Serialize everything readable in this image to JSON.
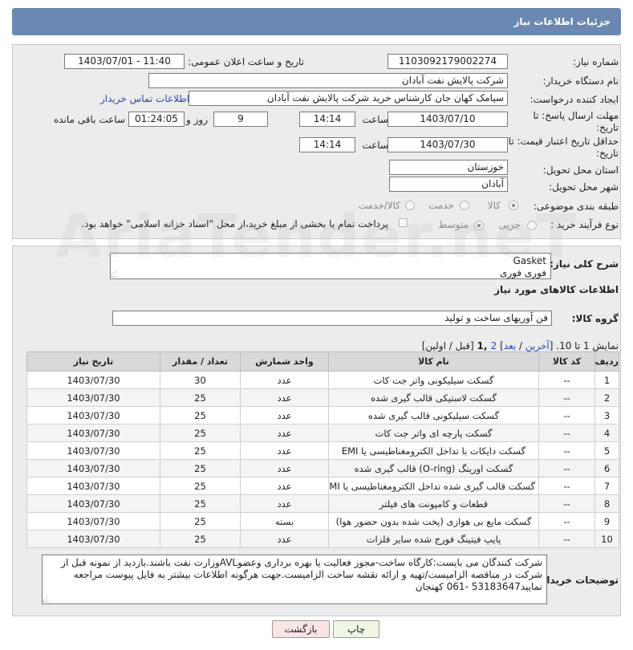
{
  "page": {
    "title": "جزئیات اطلاعات نیاز"
  },
  "form": {
    "need_number_label": "شماره نیاز:",
    "need_number": "1103092179002274",
    "announce_label": "تاریخ و ساعت اعلان عمومی:",
    "announce_value": "1403/07/01 - 11:40",
    "buyer_org_label": "نام دستگاه خریدار:",
    "buyer_org": "شرکت پالایش نفت آبادان",
    "creator_label": "ایجاد کننده درخواست:",
    "creator": "سیامک کهان جان کارشناس خرید شرکت پالایش نفت آبادان",
    "buyer_contact_link": "اطلاعات تماس خریدار",
    "reply_deadline_label": "مهلت ارسال پاسخ: تا تاریخ:",
    "reply_date": "1403/07/10",
    "time_label": "ساعت",
    "reply_time": "14:14",
    "days_value": "9",
    "days_label": "روز و",
    "remaining_time": "01:24:05",
    "remaining_label": "ساعت باقی مانده",
    "price_validity_label": "حداقل تاریخ اعتبار قیمت: تا تاریخ:",
    "price_date": "1403/07/30",
    "price_time": "14:14",
    "province_label": "استان محل تحویل:",
    "province": "خوزستان",
    "city_label": "شهر محل تحویل:",
    "city": "آبادان",
    "category_label": "طبقه بندی موضوعی:",
    "category_options": [
      "کالا",
      "خدمت",
      "کالا/خدمت"
    ],
    "process_label": "نوع فرآیند خرید :",
    "process_options": [
      "جزیی",
      "متوسط"
    ],
    "payment_note": "پرداخت تمام یا بخشی از مبلغ خرید،از محل \"اسناد خزانه اسلامی\" خواهد بود."
  },
  "watermark": "AriaTender.neT",
  "items_section": {
    "summary_label": "شرح کلی نیاز:",
    "summary_line1": "Gasket",
    "summary_line2": "فوری فوری",
    "goods_info_title": "اطلاعات کالاهای مورد نیاز",
    "goods_group_label": "گروه کالا:",
    "goods_group": "فن آوریهای ساخت و تولید",
    "pagination": {
      "prefix": "نمایش 1 تا 10. [",
      "last": "آخرین",
      "sep1": " / ",
      "next": "بعد",
      "sep2": "] ",
      "page2": "2",
      "page1": " ,1",
      "rest": " [قبل / اولین]"
    },
    "columns": [
      "ردیف",
      "کد کالا",
      "نام کالا",
      "واحد شمارش",
      "تعداد / مقدار",
      "تاریخ نیاز"
    ],
    "rows": [
      [
        "1",
        "--",
        "گسکت سیلیکونی واتر جت کات",
        "عدد",
        "30",
        "1403/07/30"
      ],
      [
        "2",
        "--",
        "گسکت لاستیکی قالب گیری شده",
        "عدد",
        "25",
        "1403/07/30"
      ],
      [
        "3",
        "--",
        "گسکت سیلیکونی قالب گیری شده",
        "عدد",
        "25",
        "1403/07/30"
      ],
      [
        "4",
        "--",
        "گسکت پارچه ای واتر جت کات",
        "عدد",
        "25",
        "1403/07/30"
      ],
      [
        "5",
        "--",
        "گسکت دایکات با تداخل الکترومغناطیسی یا EMI",
        "عدد",
        "25",
        "1403/07/30"
      ],
      [
        "6",
        "--",
        "گسکت اورینگ (O-ring) قالب گیری شده",
        "عدد",
        "25",
        "1403/07/30"
      ],
      [
        "7",
        "--",
        "گسکت قالب گیری شده تداخل الکترومغناطیسی یا EMI",
        "عدد",
        "25",
        "1403/07/30"
      ],
      [
        "8",
        "--",
        "قطعات و کامپونت های فیلتر",
        "عدد",
        "25",
        "1403/07/30"
      ],
      [
        "9",
        "--",
        "گسکت مایع بی هوازی (پخت شده بدون حضور هوا)",
        "بسته",
        "25",
        "1403/07/30"
      ],
      [
        "10",
        "--",
        "پایپ فیتینگ فورج شده سایر فلزات",
        "عدد",
        "25",
        "1403/07/30"
      ]
    ],
    "buyer_notes_label": "توضیحات خریدار:",
    "buyer_notes": "شرکت کنندگان می بایست:کارگاه ساخت-مجوز فعالیت یا بهره برداری وعضوAVLوزارت نفت باشند.بازدید از نمونه قبل از شرکت در مناقصه الزامیست/تهیه و ارائه نقشه ساخت الزامیست.جهت هرگونه اطلاعات بیشتر به فایل پیوست مراجعه نمایید53183647 -061 کهنجان"
  },
  "buttons": {
    "print": "چاپ",
    "back": "بازگشت"
  }
}
